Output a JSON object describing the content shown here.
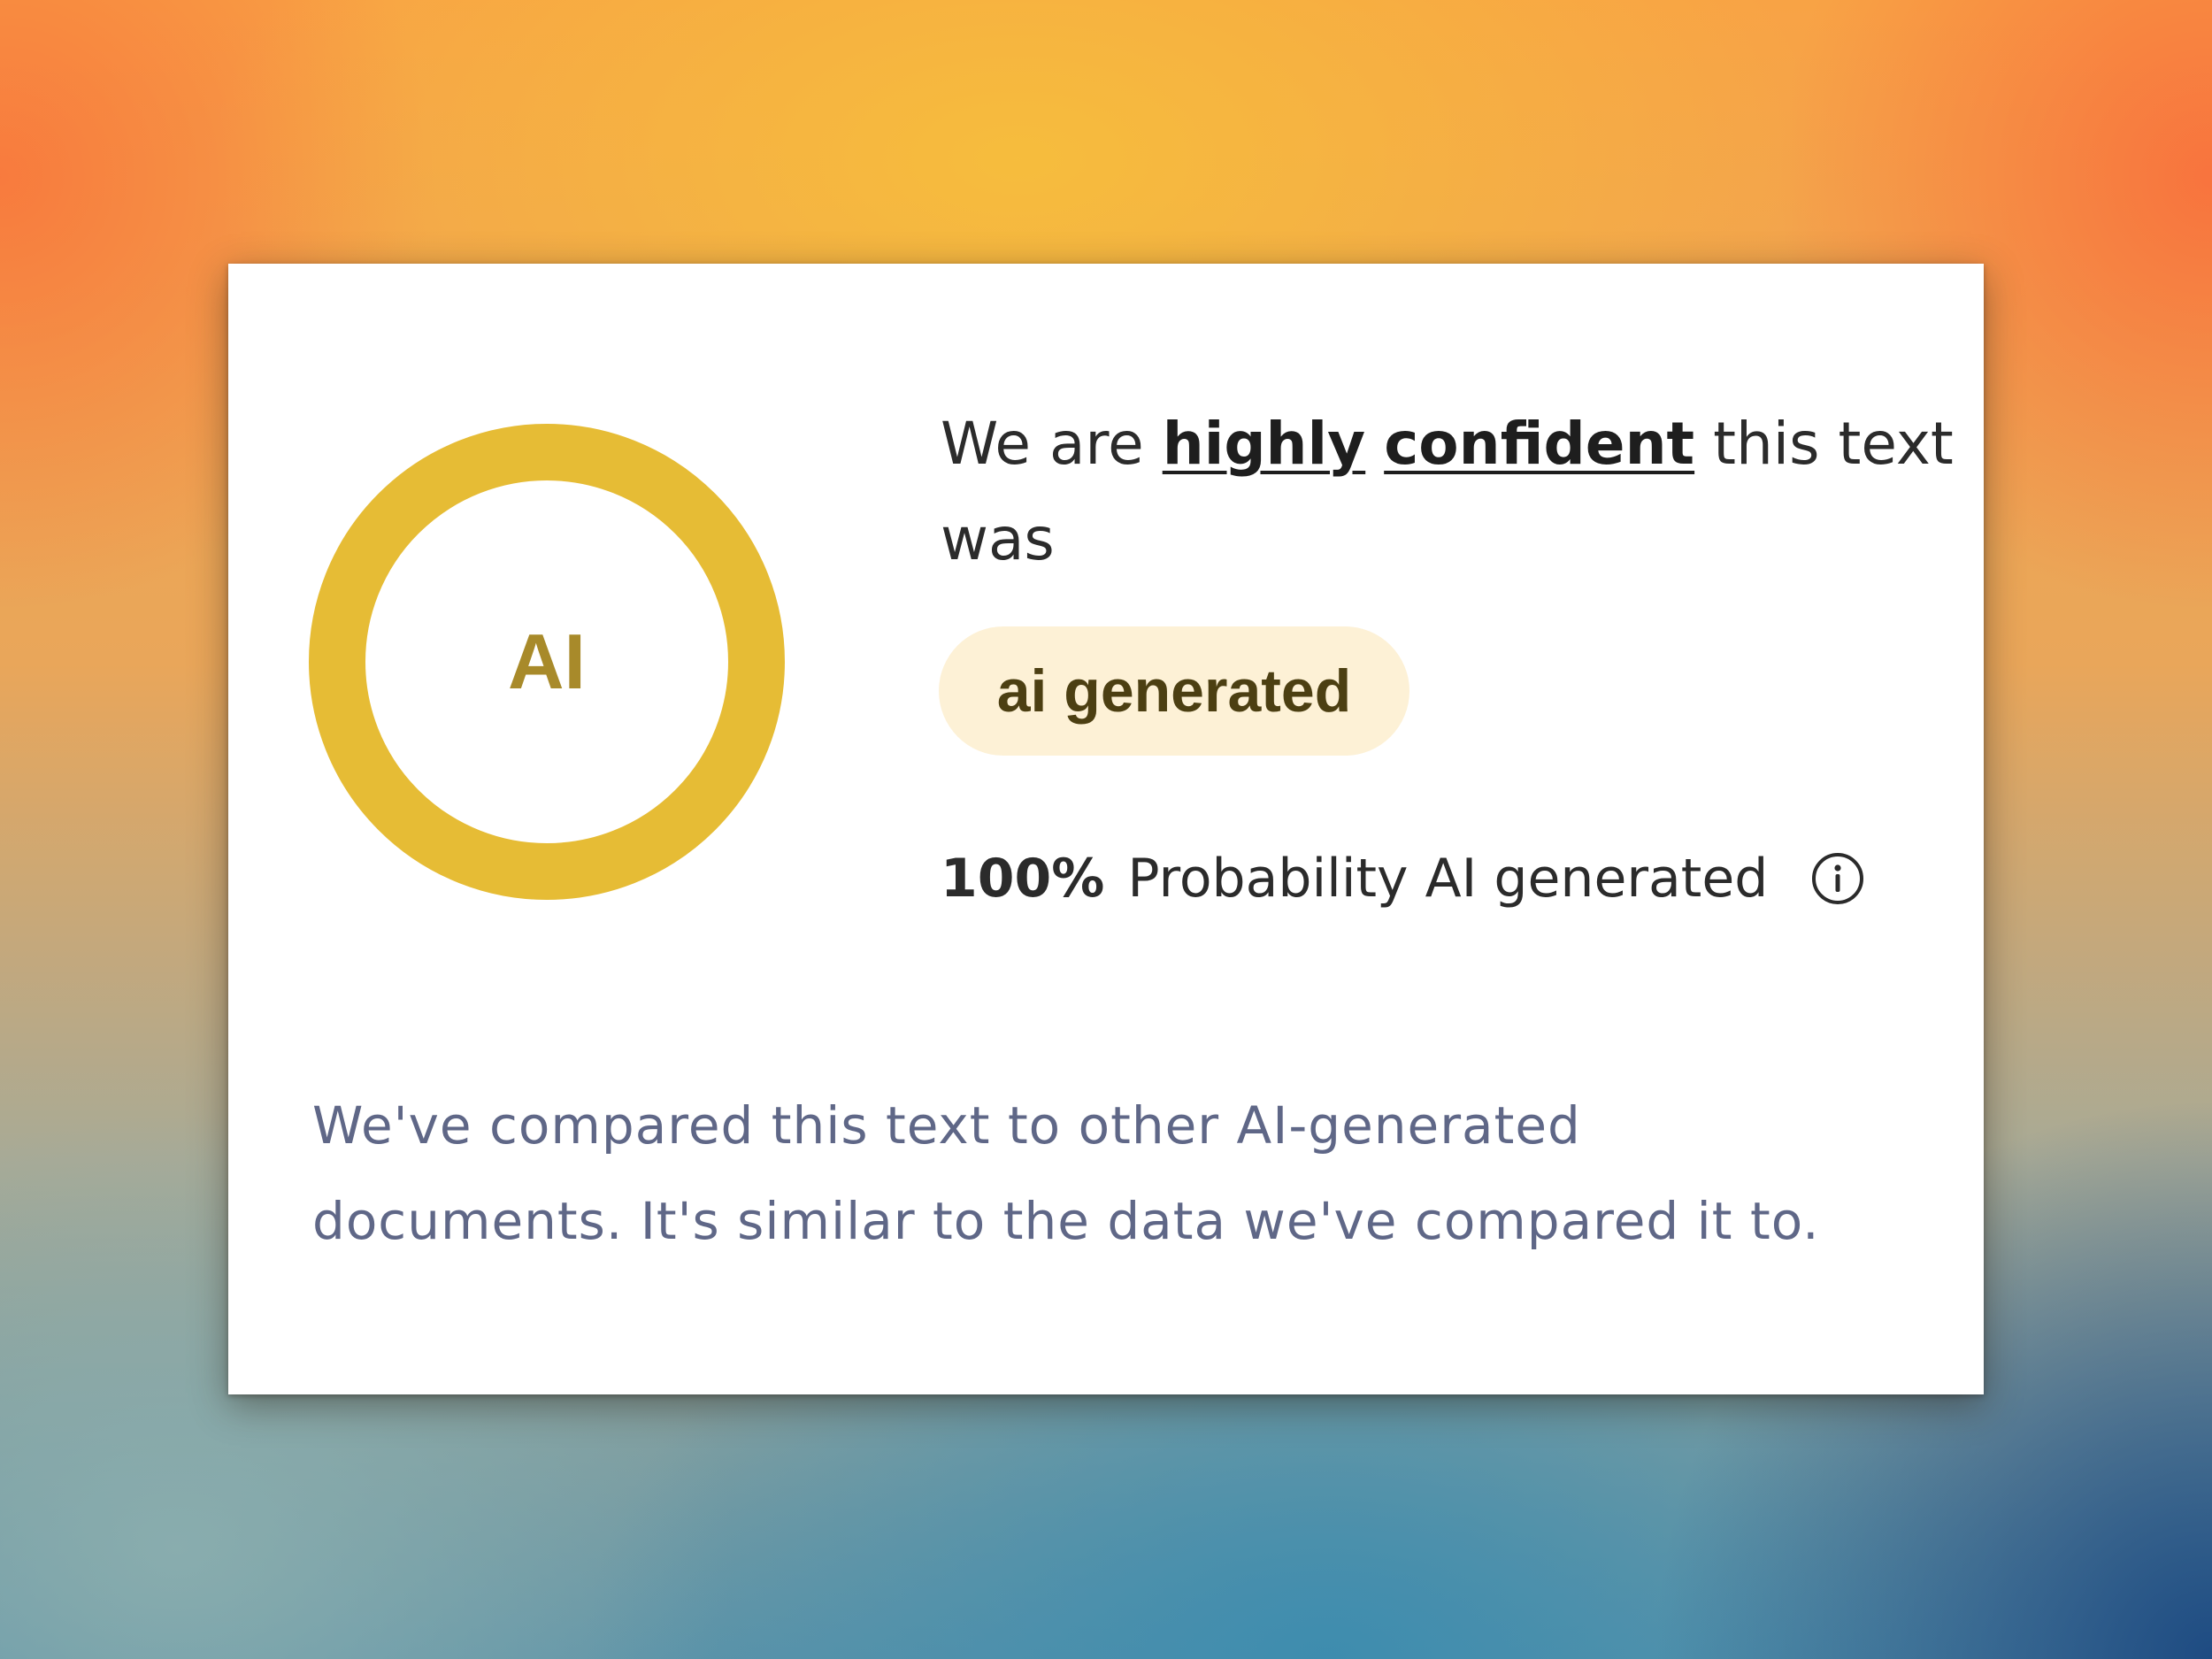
{
  "ring": {
    "label": "AI",
    "color": "#e6bc35"
  },
  "headline": {
    "prefix": "We are",
    "emphasis_1": "highly",
    "emphasis_2": "confident",
    "suffix": "this text was"
  },
  "badge": {
    "label": "ai generated",
    "background": "#fdf1d6"
  },
  "probability": {
    "value": "100%",
    "label": "Probability AI generated",
    "info_icon": "info-icon"
  },
  "description": {
    "line_1": "We've compared this text to other AI-generated",
    "line_2": "documents. It's similar to the data we've compared it to."
  }
}
